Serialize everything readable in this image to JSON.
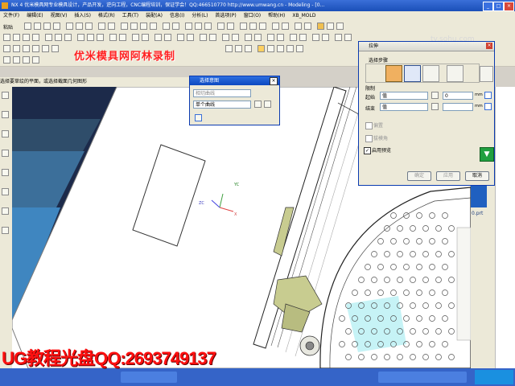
{
  "window": {
    "title": "NX 4 优米模具网专业模具设计，产品开发，逆向工程，CNC编程培训，保证学会！QQ:466510770  http://www.umwang.cn - Modeling - [0...",
    "minimize": "_",
    "maximize": "□",
    "close": "×"
  },
  "menu": {
    "items": [
      "文件(F)",
      "编辑(E)",
      "视图(V)",
      "插入(S)",
      "格式(R)",
      "工具(T)",
      "装配(A)",
      "信息(I)",
      "分析(L)",
      "首选项(P)",
      "窗口(O)",
      "帮助(H)",
      "XB_MOLD"
    ]
  },
  "toolbar": {
    "paste_label": "粘贴"
  },
  "prompt": {
    "text": "选择要草绘的平面，或选择截面几何图形"
  },
  "watermarks": {
    "top": "优米模具网阿林录制",
    "bottom": "UG教程光盘QQ:2693749137",
    "sohu": "tv.sohu.com"
  },
  "selection_bar": {
    "title": "选择意图",
    "filter_value": "相切曲线",
    "intent_value": "单个曲线"
  },
  "extrude": {
    "title": "拉伸",
    "select_step_label": "选择步骤",
    "limits_label": "限制",
    "start_label": "起始",
    "start_mode": "值",
    "start_value": "0",
    "end_label": "结束",
    "end_mode": "值",
    "end_value": "",
    "unit": "mm",
    "check_draft": "偏置",
    "check_offset": "拔模角",
    "check_preview": "启用预览",
    "preview_checked": true,
    "ok_label": "确定",
    "apply_label": "应用",
    "cancel_label": "取消"
  },
  "graphics": {
    "axis_x": "X",
    "axis_y": "YC",
    "axis_z": "ZC",
    "part_label": "0.prt"
  },
  "colors": {
    "title_blue": "#1a4fb8",
    "grad_1": "#1c2a4a",
    "grad_2": "#2f4d6a",
    "grad_3": "#3c6f9a",
    "grad_4": "#3f86c0",
    "model_green": "#c8cc90",
    "cyan_patch": "#b8f0f4",
    "watermark_red": "#ff2020"
  }
}
